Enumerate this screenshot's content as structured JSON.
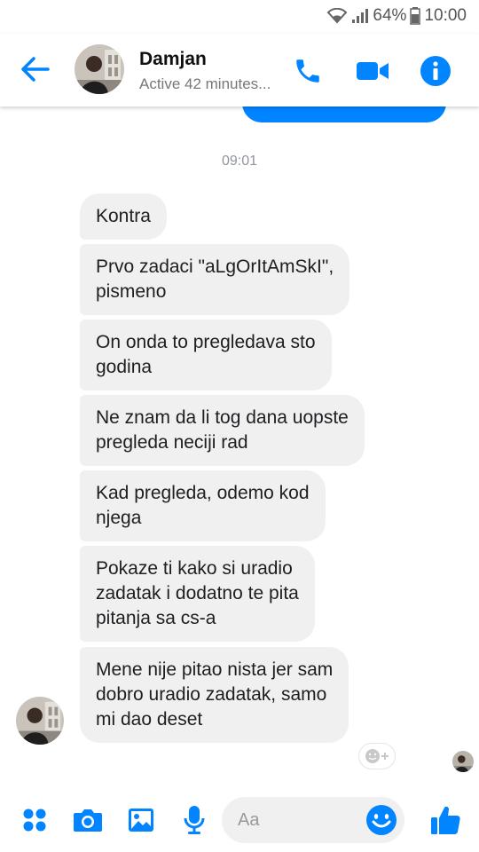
{
  "status_bar": {
    "battery_percent": "64%",
    "time": "10:00"
  },
  "header": {
    "contact_name": "Damjan",
    "contact_status": "Active 42 minutes..."
  },
  "conversation": {
    "timestamp": "09:01",
    "messages": [
      {
        "sender": "Damjan",
        "text": "Kontra"
      },
      {
        "sender": "Damjan",
        "text": "Prvo zadaci \"aLgOrItAmSkI\",\npismeno"
      },
      {
        "sender": "Damjan",
        "text": "On onda to pregledava sto\ngodina"
      },
      {
        "sender": "Damjan",
        "text": "Ne znam da li tog dana uopste\npregleda neciji rad"
      },
      {
        "sender": "Damjan",
        "text": "Kad pregleda, odemo kod\nnjega"
      },
      {
        "sender": "Damjan",
        "text": "Pokaze ti kako si uradio\nzadatak i dodatno te pita\npitanja sa cs-a"
      },
      {
        "sender": "Damjan",
        "text": "Mene nije pitao nista jer sam\ndobro uradio zadatak, samo\nmi dao deset"
      }
    ]
  },
  "composer": {
    "placeholder": "Aa"
  },
  "colors": {
    "accent": "#0084ff",
    "bubble_incoming": "#f1f0f0",
    "text_secondary": "#90949c"
  },
  "icons": {
    "back": "arrow-left-icon",
    "call": "phone-icon",
    "video": "video-camera-icon",
    "info": "info-icon",
    "more": "four-dots-icon",
    "camera": "camera-icon",
    "gallery": "image-icon",
    "mic": "microphone-icon",
    "emoji": "smiley-icon",
    "like": "thumbs-up-icon",
    "react": "add-reaction-icon"
  }
}
